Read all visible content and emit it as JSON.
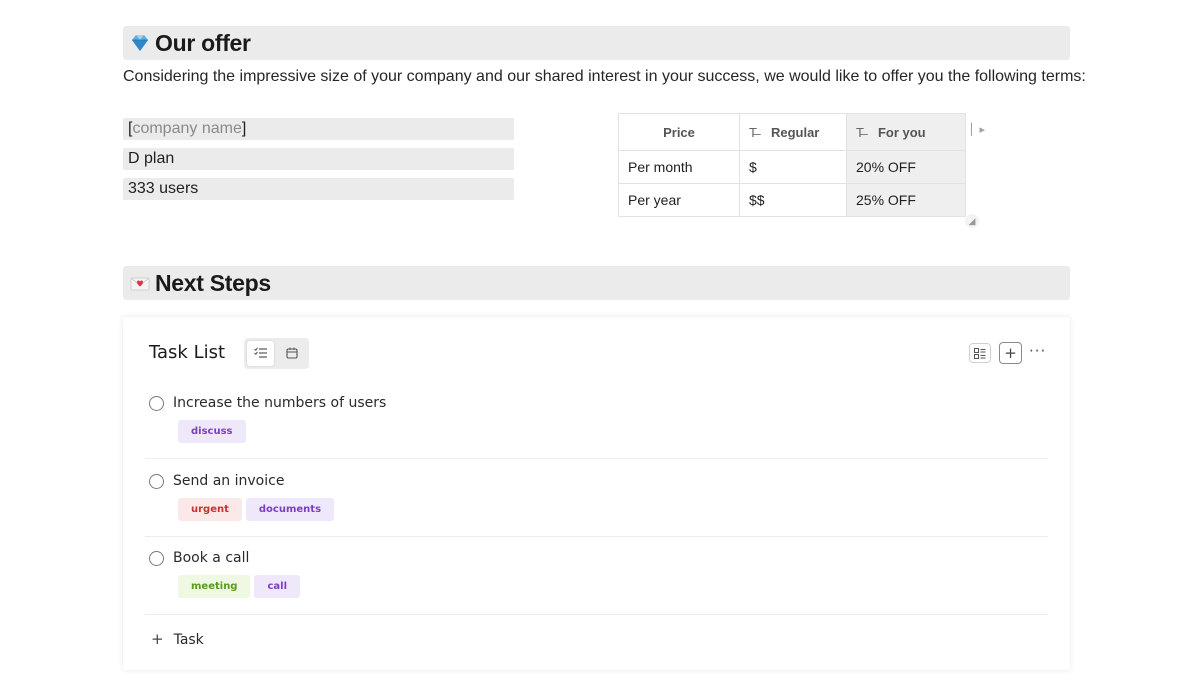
{
  "offer": {
    "emoji": "gem-icon",
    "title": "Our offer",
    "intro": "Considering the impressive size of your company and our shared interest in your success, we would like to offer you the following terms:",
    "fields": [
      {
        "prefix": "[",
        "placeholder": "company name",
        "suffix": "]"
      },
      {
        "text": "D plan"
      },
      {
        "text": "333 users"
      }
    ]
  },
  "pricing_table": {
    "headers": [
      "Price",
      "Regular",
      "For you"
    ],
    "header_icon": "text-type-icon",
    "rows": [
      [
        "Per month",
        "$",
        "20% OFF"
      ],
      [
        "Per year",
        "$$",
        "25% OFF"
      ]
    ]
  },
  "next_steps": {
    "emoji": "love-letter-icon",
    "title": "Next Steps"
  },
  "task_list": {
    "title": "Task List",
    "views": [
      "list-view-icon",
      "calendar-view-icon"
    ],
    "tools": [
      "board-view-icon",
      "add-icon",
      "more-icon"
    ],
    "tasks": [
      {
        "title": "Increase the numbers of users",
        "tags": [
          {
            "label": "discuss",
            "color": "#7b3fc4",
            "bg": "#efe8fb"
          }
        ]
      },
      {
        "title": "Send an invoice",
        "tags": [
          {
            "label": "urgent",
            "color": "#c0352f",
            "bg": "#fbe9e9"
          },
          {
            "label": "documents",
            "color": "#7b3fc4",
            "bg": "#efe8fb"
          }
        ]
      },
      {
        "title": "Book a call",
        "tags": [
          {
            "label": "meeting",
            "color": "#5a9a1e",
            "bg": "#eef8e3"
          },
          {
            "label": "call",
            "color": "#7b3fc4",
            "bg": "#efe8fb"
          }
        ]
      }
    ],
    "add_task_label": "Task"
  }
}
